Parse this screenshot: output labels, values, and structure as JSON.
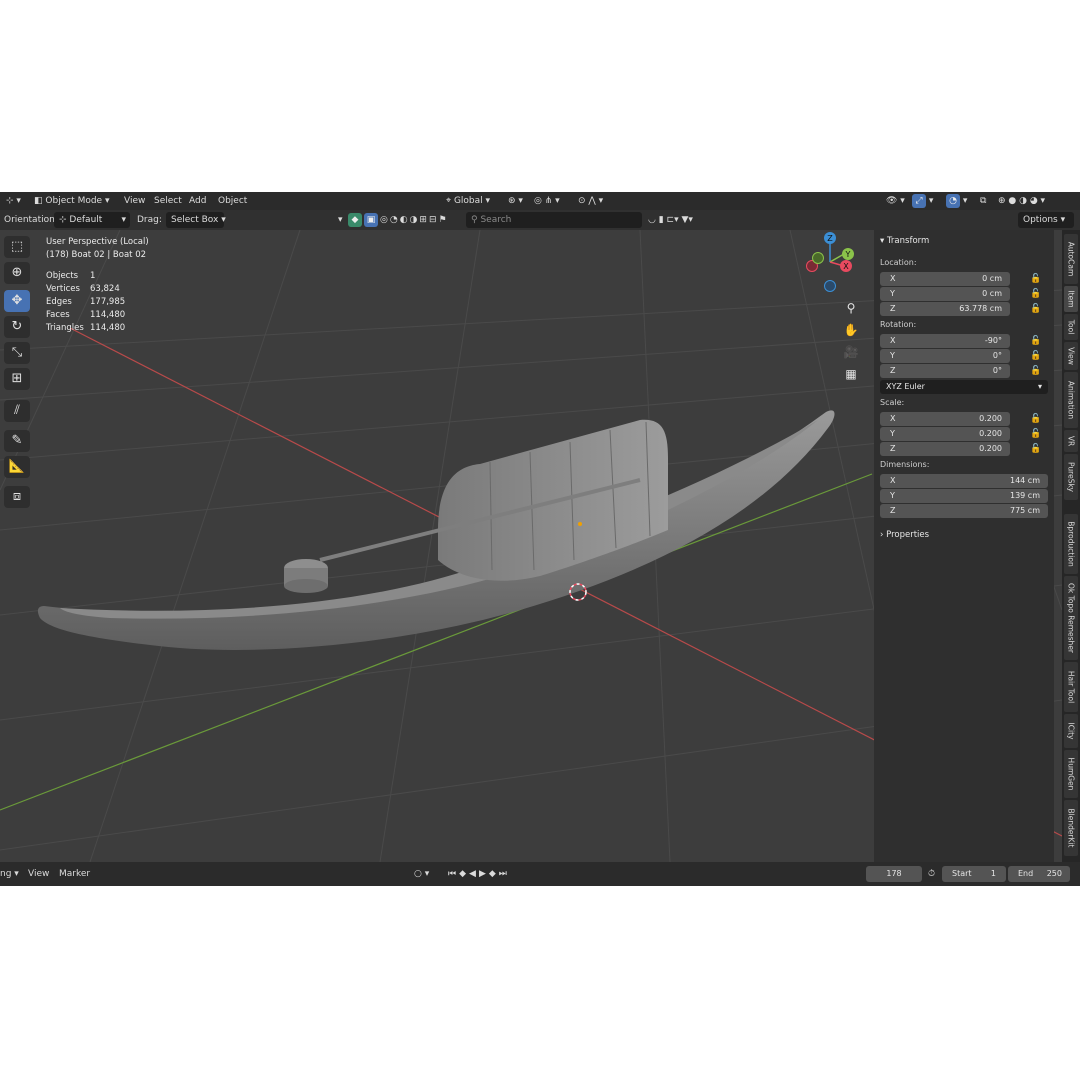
{
  "header": {
    "mode": "Object Mode",
    "menus": [
      "View",
      "Select",
      "Add",
      "Object"
    ],
    "transform_space": "Global"
  },
  "tool_header": {
    "orientation_label": "Orientation:",
    "orientation_value": "Default",
    "drag_label": "Drag:",
    "drag_value": "Select Box",
    "search_placeholder": "Search",
    "options_label": "Options"
  },
  "viewport": {
    "view_name": "User Perspective (Local)",
    "object_info": "(178) Boat 02 | Boat 02",
    "stats": [
      {
        "label": "Objects",
        "value": "1"
      },
      {
        "label": "Vertices",
        "value": "63,824"
      },
      {
        "label": "Edges",
        "value": "177,985"
      },
      {
        "label": "Faces",
        "value": "114,480"
      },
      {
        "label": "Triangles",
        "value": "114,480"
      }
    ],
    "gizmo": {
      "x": "X",
      "y": "Y",
      "z": "Z"
    }
  },
  "transform_panel": {
    "title": "Transform",
    "location_label": "Location:",
    "location": [
      {
        "axis": "X",
        "value": "0 cm"
      },
      {
        "axis": "Y",
        "value": "0 cm"
      },
      {
        "axis": "Z",
        "value": "63.778 cm"
      }
    ],
    "rotation_label": "Rotation:",
    "rotation": [
      {
        "axis": "X",
        "value": "-90°"
      },
      {
        "axis": "Y",
        "value": "0°"
      },
      {
        "axis": "Z",
        "value": "0°"
      }
    ],
    "rotation_mode": "XYZ Euler",
    "scale_label": "Scale:",
    "scale": [
      {
        "axis": "X",
        "value": "0.200"
      },
      {
        "axis": "Y",
        "value": "0.200"
      },
      {
        "axis": "Z",
        "value": "0.200"
      }
    ],
    "dimensions_label": "Dimensions:",
    "dimensions": [
      {
        "axis": "X",
        "value": "144 cm"
      },
      {
        "axis": "Y",
        "value": "139 cm"
      },
      {
        "axis": "Z",
        "value": "775 cm"
      }
    ],
    "properties_label": "Properties"
  },
  "sidebar_tabs": [
    "AutoCam",
    "Item",
    "Tool",
    "View",
    "Animation",
    "VR",
    "PureSky",
    "Bproduction",
    "Ok Topo Remesher",
    "Hair Tool",
    "ICity",
    "HumGen",
    "BlenderKit"
  ],
  "timeline": {
    "mode_fragment": "ng",
    "view_label": "View",
    "marker_label": "Marker",
    "current_frame": "178",
    "start_label": "Start",
    "start_value": "1",
    "end_label": "End",
    "end_value": "250"
  },
  "colors": {
    "accent": "#4772b3",
    "axis_x": "#e84a5f",
    "axis_y": "#8bc34a",
    "axis_z": "#3b8fd6"
  }
}
